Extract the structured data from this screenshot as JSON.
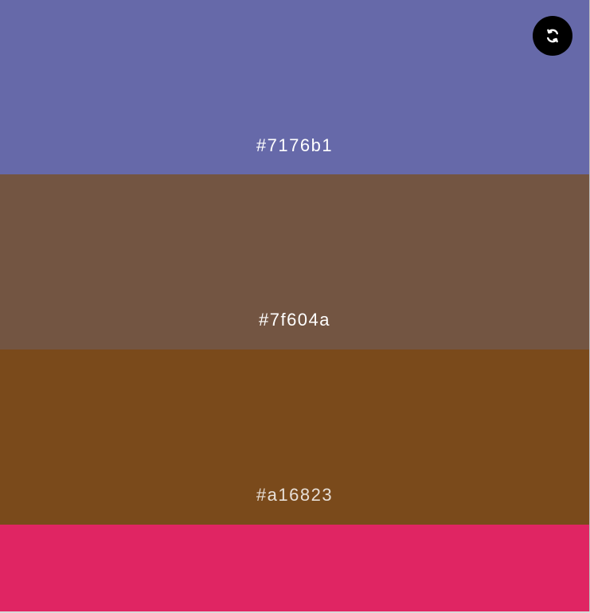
{
  "swatches": [
    {
      "hex_label": "#7176b1",
      "display_color": "#6669a9",
      "label_color": "#ffffff"
    },
    {
      "hex_label": "#7f604a",
      "display_color": "#735542",
      "label_color": "#ffffff"
    },
    {
      "hex_label": "#a16823",
      "display_color": "#7a4a1b",
      "label_color": "#e7dfd7"
    },
    {
      "hex_label": "",
      "display_color": "#e02563",
      "label_color": "#ffffff"
    }
  ],
  "controls": {
    "refresh_icon": "refresh-icon",
    "refresh_button_color": "#000000"
  }
}
